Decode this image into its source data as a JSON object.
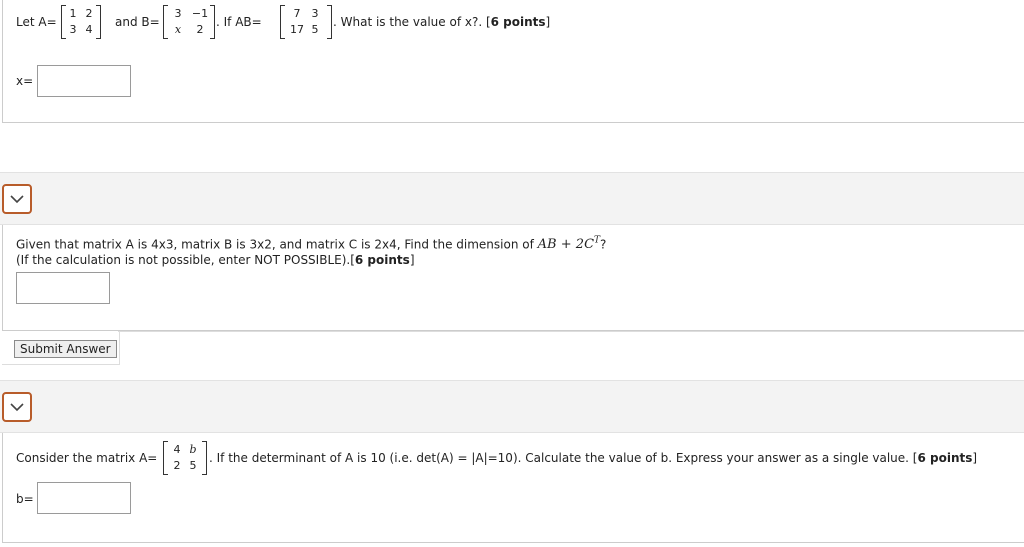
{
  "q1": {
    "let": "Let A=",
    "a": [
      "1",
      "2",
      "3",
      "4"
    ],
    "and": "and B=",
    "b": [
      "3",
      "−1",
      "x",
      "2"
    ],
    "if": ". If AB=",
    "ab": [
      "7",
      "3",
      "17",
      "5"
    ],
    "question": ". What is the value of x?. [",
    "points": "6 points",
    "close": "]",
    "answer_label": "x=",
    "answer_value": ""
  },
  "q2": {
    "text_pre": "Given that matrix A is 4x3, matrix B is 3x2, and matrix C is 2x4, Find the dimension of",
    "math_ab": "AB",
    "math_plus": "+",
    "math_c": "2C",
    "math_sup": "T",
    "math_q": "?",
    "line2": "(If the calculation is not possible, enter NOT POSSIBLE).[",
    "points": "6 points",
    "close": "]",
    "answer_value": "",
    "submit_label": "Submit Answer"
  },
  "q3": {
    "consider": "Consider the matrix A=",
    "a": [
      "4",
      "b",
      "2",
      "5"
    ],
    "text": ". If the determinant of A is 10 (i.e. det(A) = |A|=10). Calculate the value of b. Express your answer as a single value. [",
    "points": "6 points",
    "close": "]",
    "answer_label": "b=",
    "answer_value": ""
  },
  "icons": {
    "toggle": "chevron-down-icon",
    "accent": "#b85c2a"
  }
}
